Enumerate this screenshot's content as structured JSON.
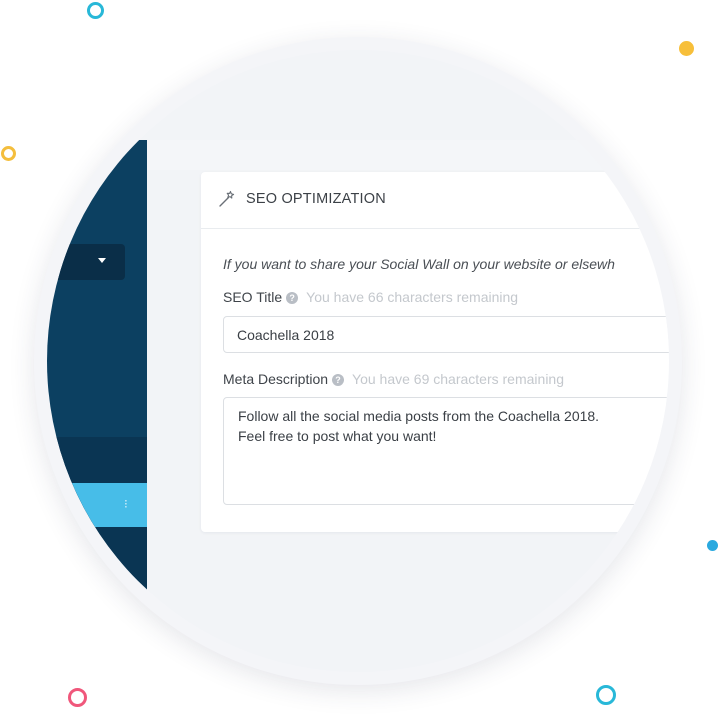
{
  "colors": {
    "sidebar_bg": "#0c4061",
    "sidebar_active": "#47bde8",
    "card_bg": "#ffffff",
    "page_bg": "#f2f4f7",
    "accent_teal": "#28b8d8",
    "accent_yellow": "#f7bf3a",
    "accent_pink": "#f0577b"
  },
  "sidebar": {
    "select_icon": "caret-down-icon",
    "active_item_icon": "dots-icon",
    "footer_icon": "chevron-right-icon"
  },
  "seo": {
    "header_icon": "magic-wand-icon",
    "title": "SEO OPTIMIZATION",
    "intro": "If you want to share your Social Wall on your website or elsewh",
    "seo_title": {
      "label": "SEO Title",
      "help_icon": "question-circle-icon",
      "remaining": "You have 66 characters remaining",
      "value": "Coachella 2018"
    },
    "meta_description": {
      "label": "Meta Description",
      "help_icon": "question-circle-icon",
      "remaining": "You have 69 characters remaining",
      "lines": [
        "Follow all the social media posts from the Coachella 2018.",
        "Feel free to post what you want!"
      ]
    }
  }
}
